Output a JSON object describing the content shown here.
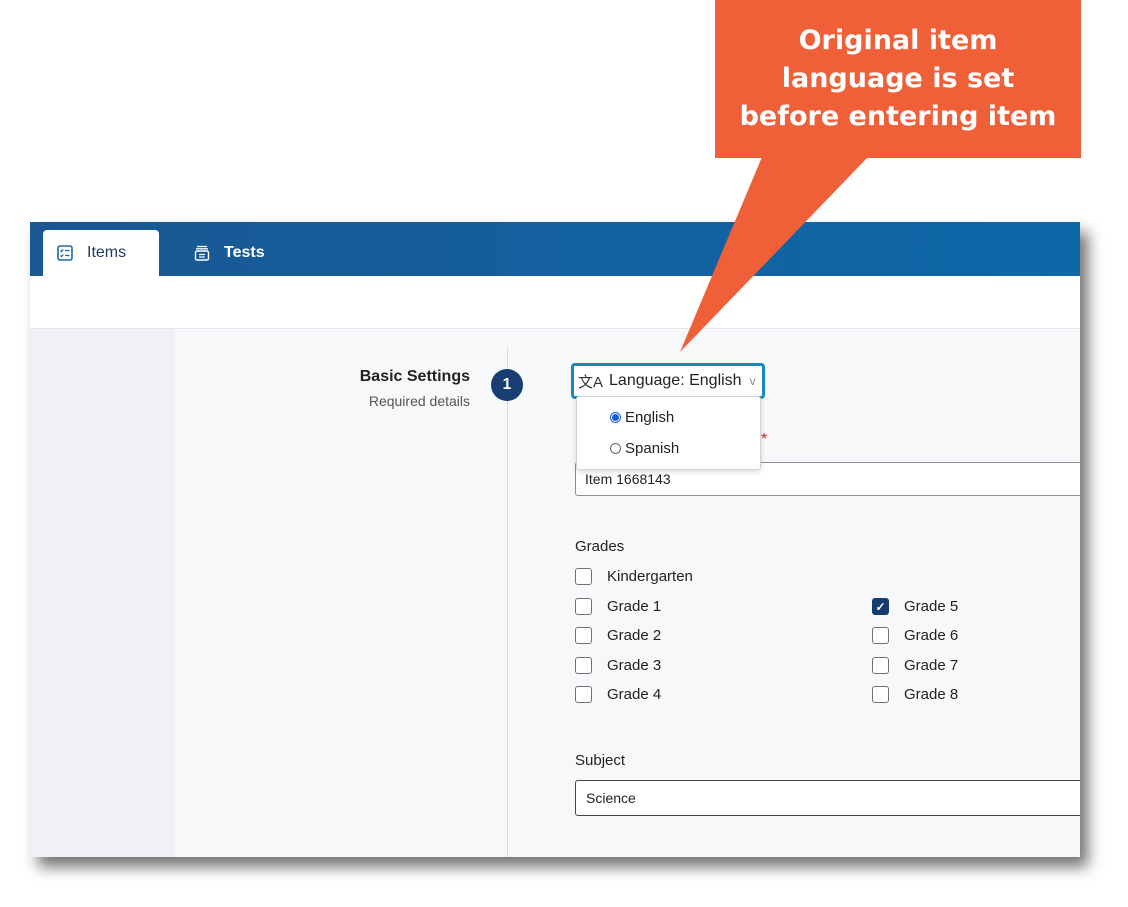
{
  "callout": {
    "lines": [
      "Original item",
      "language is set",
      "before entering item"
    ],
    "color": "#ef6038"
  },
  "nav": {
    "tabs": [
      {
        "label": "Items",
        "icon": "checklist-icon",
        "active": true
      },
      {
        "label": "Tests",
        "icon": "test-stack-icon",
        "active": false
      }
    ]
  },
  "section": {
    "title": "Basic Settings",
    "subtitle": "Required details",
    "step": "1"
  },
  "language": {
    "button_label": "Language: English",
    "icon": "translate-icon",
    "options": [
      {
        "label": "English",
        "selected": true
      },
      {
        "label": "Spanish",
        "selected": false
      }
    ]
  },
  "item_name": {
    "value": "Item 1668143",
    "required_mark": "*"
  },
  "grades": {
    "label": "Grades",
    "items": [
      {
        "label": "Kindergarten",
        "checked": false
      },
      {
        "label": "Grade 1",
        "checked": false
      },
      {
        "label": "Grade 2",
        "checked": false
      },
      {
        "label": "Grade 3",
        "checked": false
      },
      {
        "label": "Grade 4",
        "checked": false
      },
      {
        "label": "Grade 5",
        "checked": true
      },
      {
        "label": "Grade 6",
        "checked": false
      },
      {
        "label": "Grade 7",
        "checked": false
      },
      {
        "label": "Grade 8",
        "checked": false
      }
    ]
  },
  "subject": {
    "label": "Subject",
    "value": "Science"
  }
}
